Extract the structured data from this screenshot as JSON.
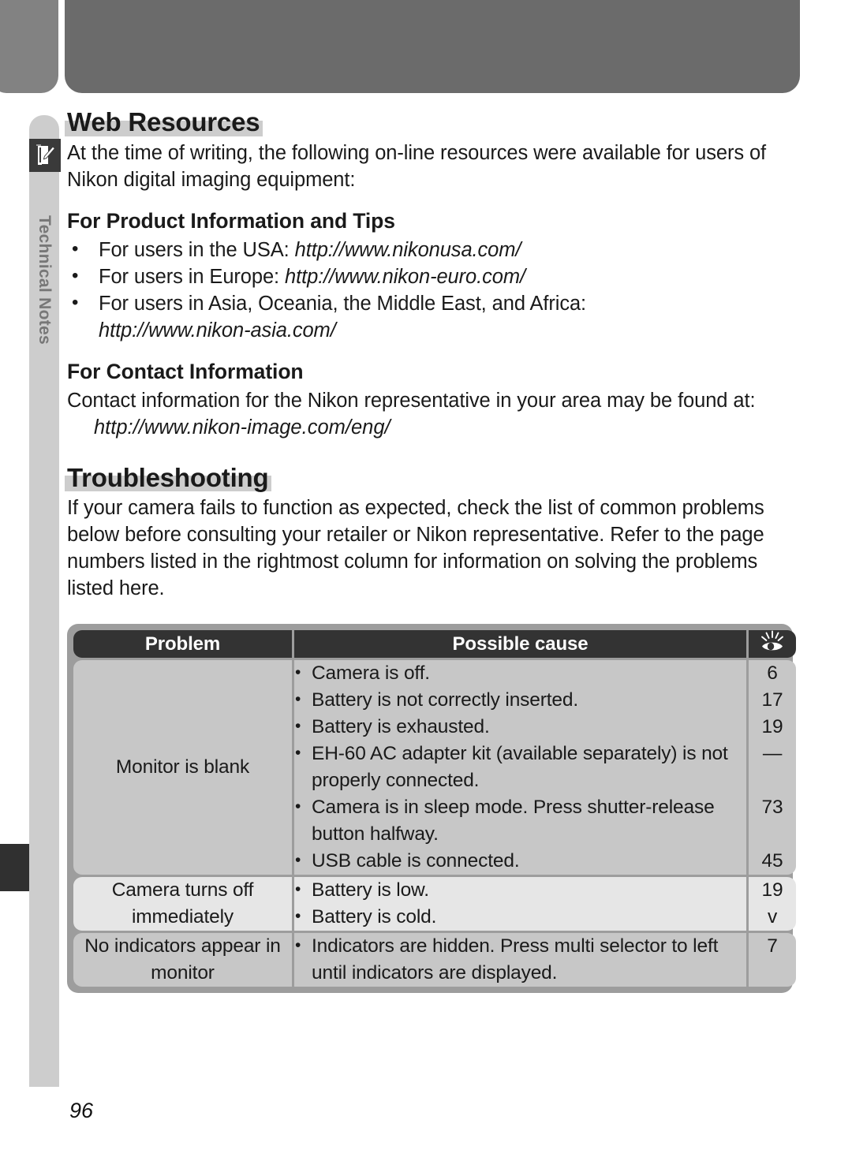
{
  "chapter_tab": {
    "label": "Technical Notes",
    "icon": "notes-pencil-icon"
  },
  "sections": {
    "web_resources": {
      "heading": "Web Resources",
      "intro": "At the time of writing, the following on-line resources were available for users of Nikon digital imaging equipment:",
      "product_info": {
        "heading": "For Product Information and Tips",
        "bullets": [
          {
            "text": "For users in the USA: ",
            "url": "http://www.nikonusa.com/"
          },
          {
            "text": "For users in Europe: ",
            "url": "http://www.nikon-euro.com/"
          },
          {
            "text": "For users in Asia, Oceania, the Middle East, and Africa:",
            "url": "http://www.nikon-asia.com/"
          }
        ]
      },
      "contact_info": {
        "heading": "For Contact Information",
        "text": "Contact information for the Nikon representative in your area may be found at:",
        "url": "http://www.nikon-image.com/eng/"
      }
    },
    "troubleshooting": {
      "heading": "Troubleshooting",
      "intro": "If your camera fails to function as expected, check the list of common problems below before consulting your retailer or Nikon representative.  Refer to the page numbers listed in the rightmost column for information on solving the problems listed here.",
      "table": {
        "columns": [
          "Problem",
          "Possible cause",
          "eye-page-reference-icon"
        ],
        "rows": [
          {
            "problem": "Monitor is blank",
            "causes": [
              {
                "text": "Camera is off.",
                "page": "6"
              },
              {
                "text": "Battery is not correctly inserted.",
                "page": "17"
              },
              {
                "text": "Battery is exhausted.",
                "page": "19"
              },
              {
                "text": "EH-60 AC adapter kit (available separately) is not properly connected.",
                "page": "—"
              },
              {
                "text": "Camera is in sleep mode.  Press shutter-release button halfway.",
                "page": "73"
              },
              {
                "text": "USB cable is connected.",
                "page": "45"
              }
            ]
          },
          {
            "problem": "Camera turns off immediately",
            "causes": [
              {
                "text": "Battery is low.",
                "page": "19"
              },
              {
                "text": "Battery is cold.",
                "page": "v"
              }
            ]
          },
          {
            "problem": "No indicators appear in monitor",
            "causes": [
              {
                "text": "Indicators are hidden.  Press multi selector to left until indicators are displayed.",
                "page": "7"
              }
            ]
          }
        ]
      }
    }
  },
  "folio": "96",
  "colors": {
    "header_bar_light": "#828282",
    "header_bar_dark": "#6b6b6b",
    "tab_gray": "#cdcdcd",
    "table_frame": "#9d9d9d",
    "row_dark": "#c7c7c7",
    "row_light": "#e6e6e6",
    "table_header": "#333333"
  }
}
